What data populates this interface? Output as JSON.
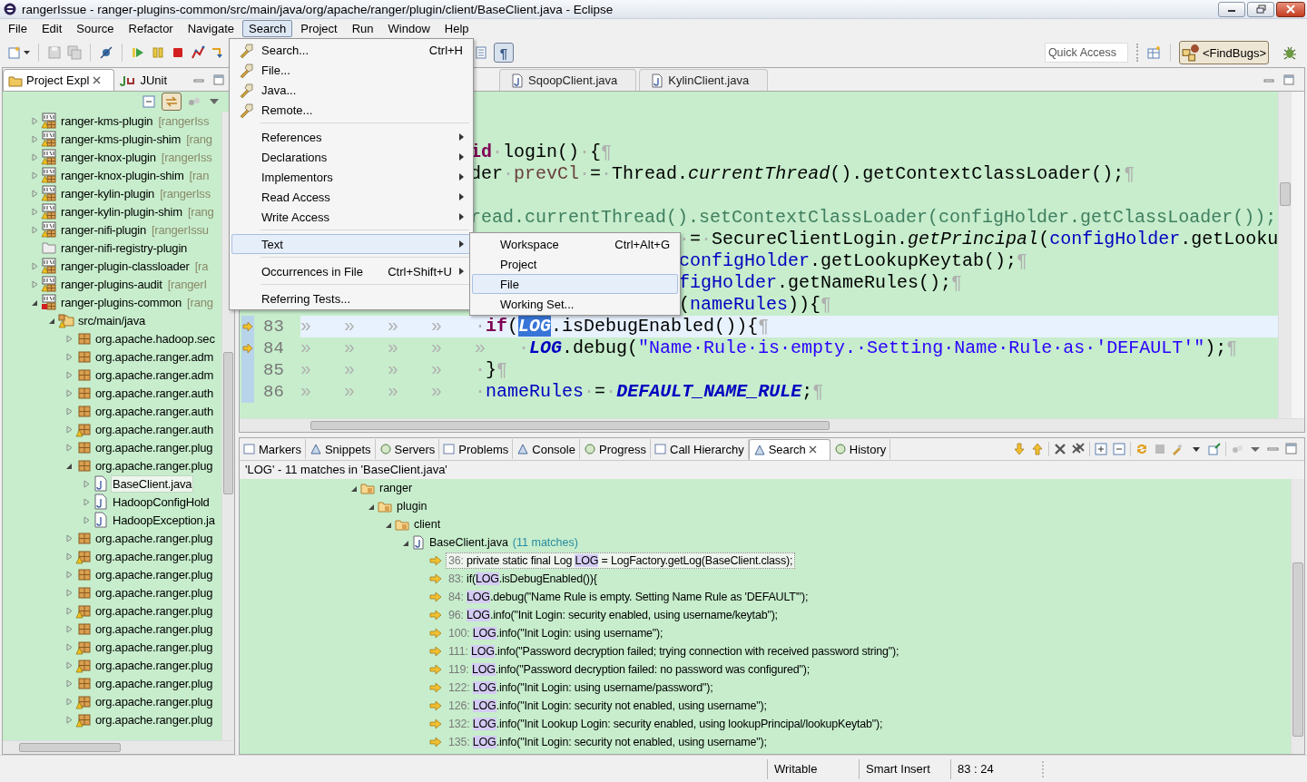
{
  "window": {
    "title": "rangerIssue - ranger-plugins-common/src/main/java/org/apache/ranger/plugin/client/BaseClient.java - Eclipse"
  },
  "menu_bar": [
    {
      "label": "File",
      "selected": false
    },
    {
      "label": "Edit",
      "selected": false
    },
    {
      "label": "Source",
      "selected": false
    },
    {
      "label": "Refactor",
      "selected": false
    },
    {
      "label": "Navigate",
      "selected": false
    },
    {
      "label": "Search",
      "selected": true
    },
    {
      "label": "Project",
      "selected": false
    },
    {
      "label": "Run",
      "selected": false
    },
    {
      "label": "Window",
      "selected": false
    },
    {
      "label": "Help",
      "selected": false
    }
  ],
  "search_menu": [
    {
      "kind": "tool",
      "label": "Search...",
      "shortcut": "Ctrl+H",
      "highlighted": false
    },
    {
      "kind": "tool",
      "label": "File...",
      "highlighted": false
    },
    {
      "kind": "tool",
      "label": "Java...",
      "highlighted": false
    },
    {
      "kind": "tool",
      "label": "Remote...",
      "highlighted": false
    },
    {
      "kind": "separator"
    },
    {
      "kind": "submenu",
      "label": "References",
      "highlighted": false
    },
    {
      "kind": "submenu",
      "label": "Declarations",
      "highlighted": false
    },
    {
      "kind": "submenu",
      "label": "Implementors",
      "highlighted": false
    },
    {
      "kind": "submenu",
      "label": "Read Access",
      "highlighted": false
    },
    {
      "kind": "submenu",
      "label": "Write Access",
      "highlighted": false
    },
    {
      "kind": "separator"
    },
    {
      "kind": "submenu",
      "label": "Text",
      "highlighted": true
    },
    {
      "kind": "separator"
    },
    {
      "kind": "submenu",
      "label": "Occurrences in File",
      "shortcut": "Ctrl+Shift+U",
      "highlighted": false
    },
    {
      "kind": "separator"
    },
    {
      "kind": "item",
      "label": "Referring Tests...",
      "highlighted": false
    }
  ],
  "text_submenu": [
    {
      "label": "Workspace",
      "shortcut": "Ctrl+Alt+G",
      "highlighted": false
    },
    {
      "label": "Project",
      "highlighted": false
    },
    {
      "label": "File",
      "highlighted": true
    },
    {
      "label": "Working Set...",
      "highlighted": false
    }
  ],
  "toolbar": {
    "whitespace_toggle": {
      "glyph": "¶",
      "on": true
    },
    "quick_access": {
      "placeholder": "Quick Access"
    },
    "perspective": {
      "label": "<FindBugs>",
      "selected": true
    }
  },
  "explorer": {
    "tabs": [
      {
        "label": "Project Expl",
        "selected": true
      },
      {
        "label": "JUnit",
        "selected": false
      }
    ],
    "link_with_editor": {
      "on": true
    },
    "tree": [
      {
        "kind": "project",
        "label": "ranger-kms-plugin",
        "decoration": "[rangerIss",
        "warning": true,
        "error": false,
        "expanded": false,
        "selected": false
      },
      {
        "kind": "project",
        "label": "ranger-kms-plugin-shim",
        "decoration": "[rang",
        "warning": true,
        "error": false,
        "expanded": false,
        "selected": false
      },
      {
        "kind": "project",
        "label": "ranger-knox-plugin",
        "decoration": "[rangerIss",
        "warning": true,
        "error": false,
        "expanded": false,
        "selected": false
      },
      {
        "kind": "project",
        "label": "ranger-knox-plugin-shim",
        "decoration": "[ran",
        "warning": true,
        "error": false,
        "expanded": false,
        "selected": false
      },
      {
        "kind": "project",
        "label": "ranger-kylin-plugin",
        "decoration": "[rangerIss",
        "warning": true,
        "error": false,
        "expanded": false,
        "selected": false
      },
      {
        "kind": "project",
        "label": "ranger-kylin-plugin-shim",
        "decoration": "[rang",
        "warning": true,
        "error": false,
        "expanded": false,
        "selected": false
      },
      {
        "kind": "project",
        "label": "ranger-nifi-plugin",
        "decoration": "[rangerIssu",
        "warning": true,
        "error": false,
        "expanded": false,
        "selected": false
      },
      {
        "kind": "folder",
        "label": "ranger-nifi-registry-plugin",
        "warning": false,
        "error": false,
        "selected": false
      },
      {
        "kind": "project",
        "label": "ranger-plugin-classloader",
        "decoration": "[ra",
        "warning": true,
        "error": false,
        "expanded": false,
        "selected": false
      },
      {
        "kind": "project",
        "label": "ranger-plugins-audit",
        "decoration": "[rangerI",
        "warning": true,
        "error": false,
        "expanded": false,
        "selected": false
      },
      {
        "kind": "project",
        "label": "ranger-plugins-common",
        "decoration": "[rang",
        "warning": false,
        "error": true,
        "expanded": true,
        "selected": false,
        "children": [
          {
            "kind": "source-folder",
            "label": "src/main/java",
            "warning": true,
            "expanded": true,
            "selected": false,
            "children": [
              {
                "kind": "package",
                "label": "org.apache.hadoop.sec",
                "warning": false,
                "expanded": false,
                "selected": false
              },
              {
                "kind": "package",
                "label": "org.apache.ranger.adm",
                "warning": false,
                "expanded": false,
                "selected": false
              },
              {
                "kind": "package",
                "label": "org.apache.ranger.adm",
                "warning": false,
                "expanded": false,
                "selected": false
              },
              {
                "kind": "package",
                "label": "org.apache.ranger.auth",
                "warning": false,
                "expanded": false,
                "selected": false
              },
              {
                "kind": "package",
                "label": "org.apache.ranger.auth",
                "warning": false,
                "expanded": false,
                "selected": false
              },
              {
                "kind": "package",
                "label": "org.apache.ranger.auth",
                "warning": true,
                "expanded": false,
                "selected": false
              },
              {
                "kind": "package",
                "label": "org.apache.ranger.plug",
                "warning": false,
                "expanded": false,
                "selected": false
              },
              {
                "kind": "package",
                "label": "org.apache.ranger.plug",
                "warning": false,
                "expanded": true,
                "selected": false,
                "children": [
                  {
                    "kind": "java-file",
                    "label": "BaseClient.java",
                    "expanded": false,
                    "selected": true
                  },
                  {
                    "kind": "java-file",
                    "label": "HadoopConfigHold",
                    "expanded": false,
                    "selected": false
                  },
                  {
                    "kind": "java-file",
                    "label": "HadoopException.ja",
                    "expanded": false,
                    "selected": false
                  }
                ]
              },
              {
                "kind": "package",
                "label": "org.apache.ranger.plug",
                "warning": false,
                "expanded": false,
                "selected": false
              },
              {
                "kind": "package",
                "label": "org.apache.ranger.plug",
                "warning": true,
                "expanded": false,
                "selected": false
              },
              {
                "kind": "package",
                "label": "org.apache.ranger.plug",
                "warning": false,
                "expanded": false,
                "selected": false
              },
              {
                "kind": "package",
                "label": "org.apache.ranger.plug",
                "warning": false,
                "expanded": false,
                "selected": false
              },
              {
                "kind": "package",
                "label": "org.apache.ranger.plug",
                "warning": true,
                "expanded": false,
                "selected": false
              },
              {
                "kind": "package",
                "label": "org.apache.ranger.plug",
                "warning": false,
                "expanded": false,
                "selected": false
              },
              {
                "kind": "package",
                "label": "org.apache.ranger.plug",
                "warning": true,
                "expanded": false,
                "selected": false
              },
              {
                "kind": "package",
                "label": "org.apache.ranger.plug",
                "warning": true,
                "expanded": false,
                "selected": false
              },
              {
                "kind": "package",
                "label": "org.apache.ranger.plug",
                "warning": false,
                "expanded": false,
                "selected": false
              },
              {
                "kind": "package",
                "label": "org.apache.ranger.plug",
                "warning": true,
                "expanded": false,
                "selected": false
              },
              {
                "kind": "package",
                "label": "org.apache.ranger.plug",
                "warning": true,
                "expanded": false,
                "selected": false
              }
            ]
          }
        ]
      }
    ]
  },
  "editor": {
    "tabs": [
      {
        "label": "SqoopClient.java",
        "selected": false
      },
      {
        "label": "KylinClient.java",
        "selected": false
      }
    ],
    "fragments": [
      {
        "kind": "blank"
      },
      {
        "kind": "blank"
      },
      {
        "kind": "after-menu",
        "segments": [
          {
            "kind": "keyword",
            "t": "id"
          },
          {
            "kind": "whitespace",
            "t": "·"
          },
          {
            "kind": "plain",
            "t": "login()"
          },
          {
            "kind": "whitespace",
            "t": "·"
          },
          {
            "kind": "plain",
            "t": "{"
          },
          {
            "kind": "whitespace",
            "t": "¶"
          }
        ]
      },
      {
        "kind": "after-menu",
        "segments": [
          {
            "kind": "plain",
            "t": "der"
          },
          {
            "kind": "whitespace",
            "t": "·"
          },
          {
            "kind": "variable",
            "t": "prevCl"
          },
          {
            "kind": "whitespace",
            "t": "·"
          },
          {
            "kind": "plain",
            "t": "="
          },
          {
            "kind": "whitespace",
            "t": "·"
          },
          {
            "kind": "plain",
            "t": "Thread."
          },
          {
            "kind": "italic",
            "t": "currentThread"
          },
          {
            "kind": "plain",
            "t": "().getContextClassLoader();"
          },
          {
            "kind": "whitespace",
            "t": "¶"
          }
        ]
      },
      {
        "kind": "blank"
      },
      {
        "kind": "after-menu",
        "segments": [
          {
            "kind": "comment",
            "t": "read.currentThread().setContextClassLoader(configHolder.getClassLoader());"
          }
        ]
      },
      {
        "kind": "after-submenu",
        "segments": [
          {
            "kind": "whitespace",
            "t": "·"
          },
          {
            "kind": "plain",
            "t": "="
          },
          {
            "kind": "whitespace",
            "t": "·"
          },
          {
            "kind": "plain",
            "t": "SecureClientLogin."
          },
          {
            "kind": "italic",
            "t": "getPrincipal"
          },
          {
            "kind": "plain",
            "t": "("
          },
          {
            "kind": "field",
            "t": "configHolder"
          },
          {
            "kind": "plain",
            "t": ".getLooku"
          }
        ]
      },
      {
        "kind": "after-submenu",
        "segments": [
          {
            "kind": "field",
            "t": "configHolder"
          },
          {
            "kind": "plain",
            "t": ".getLookupKeytab();"
          },
          {
            "kind": "whitespace",
            "t": "¶"
          }
        ]
      },
      {
        "kind": "after-submenu",
        "segments": [
          {
            "kind": "field",
            "t": "figHolder"
          },
          {
            "kind": "plain",
            "t": ".getNameRules();"
          },
          {
            "kind": "whitespace",
            "t": "¶"
          }
        ]
      },
      {
        "kind": "after-submenu",
        "segments": [
          {
            "kind": "plain",
            "t": "("
          },
          {
            "kind": "field",
            "t": "nameRules"
          },
          {
            "kind": "plain",
            "t": ")){"
          },
          {
            "kind": "whitespace",
            "t": "¶"
          }
        ]
      }
    ],
    "lines": [
      {
        "number": "83",
        "current": true,
        "marker": true,
        "segments": [
          {
            "kind": "whitespace",
            "t": "»   »   »   »   ·"
          },
          {
            "kind": "keyword",
            "t": "if"
          },
          {
            "kind": "plain",
            "t": "("
          },
          {
            "kind": "selection",
            "t": "LOG"
          },
          {
            "kind": "plain",
            "t": ".isDebugEnabled()){"
          },
          {
            "kind": "whitespace",
            "t": "¶"
          }
        ]
      },
      {
        "number": "84",
        "current": false,
        "marker": true,
        "segments": [
          {
            "kind": "whitespace",
            "t": "»   »   »   »   »   ·"
          },
          {
            "kind": "static",
            "t": "LOG"
          },
          {
            "kind": "plain",
            "t": ".debug("
          },
          {
            "kind": "string",
            "t": "\"Name·Rule·is·empty.·Setting·Name·Rule·as·'DEFAULT'\""
          },
          {
            "kind": "plain",
            "t": ");"
          },
          {
            "kind": "whitespace",
            "t": "¶"
          }
        ]
      },
      {
        "number": "85",
        "current": false,
        "marker": false,
        "segments": [
          {
            "kind": "whitespace",
            "t": "»   »   »   »   ·"
          },
          {
            "kind": "plain",
            "t": "}"
          },
          {
            "kind": "whitespace",
            "t": "¶"
          }
        ]
      },
      {
        "number": "86",
        "current": false,
        "marker": false,
        "segments": [
          {
            "kind": "whitespace",
            "t": "»   »   »   »   ·"
          },
          {
            "kind": "field",
            "t": "nameRules"
          },
          {
            "kind": "whitespace",
            "t": "·"
          },
          {
            "kind": "plain",
            "t": "="
          },
          {
            "kind": "whitespace",
            "t": "·"
          },
          {
            "kind": "static",
            "t": "DEFAULT_NAME_RULE"
          },
          {
            "kind": "plain",
            "t": ";"
          },
          {
            "kind": "whitespace",
            "t": "¶"
          }
        ]
      }
    ]
  },
  "bottom": {
    "tabs": [
      {
        "label": "Markers",
        "selected": false
      },
      {
        "label": "Snippets",
        "selected": false
      },
      {
        "label": "Servers",
        "selected": false
      },
      {
        "label": "Problems",
        "selected": false
      },
      {
        "label": "Console",
        "selected": false
      },
      {
        "label": "Progress",
        "selected": false
      },
      {
        "label": "Call Hierarchy",
        "selected": false
      },
      {
        "label": "Search",
        "selected": true
      },
      {
        "label": "History",
        "selected": false
      }
    ],
    "summary": "'LOG' - 11 matches in 'BaseClient.java'",
    "results": [
      {
        "kind": "package",
        "label": "ranger",
        "expanded": true,
        "children": [
          {
            "kind": "package",
            "label": "plugin",
            "expanded": true,
            "children": [
              {
                "kind": "package",
                "label": "client",
                "expanded": true,
                "children": [
                  {
                    "kind": "file",
                    "label": "BaseClient.java",
                    "count": "(11 matches)",
                    "expanded": true,
                    "children": [
                      {
                        "kind": "match",
                        "line": "36:",
                        "before": "private static final Log ",
                        "match": "LOG",
                        "after": " = LogFactory.getLog(BaseClient.class);",
                        "selected": true
                      },
                      {
                        "kind": "match",
                        "line": "83:",
                        "before": "if(",
                        "match": "LOG",
                        "after": ".isDebugEnabled()){",
                        "selected": false
                      },
                      {
                        "kind": "match",
                        "line": "84:",
                        "match": "LOG",
                        "after": ".debug(\"Name Rule is empty. Setting Name Rule as 'DEFAULT'\");",
                        "selected": false
                      },
                      {
                        "kind": "match",
                        "line": "96:",
                        "match": "LOG",
                        "after": ".info(\"Init Login: security enabled, using username/keytab\");",
                        "selected": false
                      },
                      {
                        "kind": "match",
                        "line": "100:",
                        "match": "LOG",
                        "after": ".info(\"Init Login: using username\");",
                        "selected": false
                      },
                      {
                        "kind": "match",
                        "line": "111:",
                        "match": "LOG",
                        "after": ".info(\"Password decryption failed; trying connection with received password string\");",
                        "selected": false
                      },
                      {
                        "kind": "match",
                        "line": "119:",
                        "match": "LOG",
                        "after": ".info(\"Password decryption failed: no password was configured\");",
                        "selected": false
                      },
                      {
                        "kind": "match",
                        "line": "122:",
                        "match": "LOG",
                        "after": ".info(\"Init Login: using username/password\");",
                        "selected": false
                      },
                      {
                        "kind": "match",
                        "line": "126:",
                        "match": "LOG",
                        "after": ".info(\"Init Login: security not enabled, using username\");",
                        "selected": false
                      },
                      {
                        "kind": "match",
                        "line": "132:",
                        "match": "LOG",
                        "after": ".info(\"Init Lookup Login: security enabled, using lookupPrincipal/lookupKeytab\");",
                        "selected": false
                      },
                      {
                        "kind": "match",
                        "line": "135:",
                        "match": "LOG",
                        "after": ".info(\"Init Login: security not enabled, using username\");",
                        "selected": false
                      }
                    ]
                  }
                ]
              }
            ]
          }
        ]
      }
    ]
  },
  "status_bar": [
    "Writable",
    "Smart Insert",
    "83 : 24"
  ]
}
